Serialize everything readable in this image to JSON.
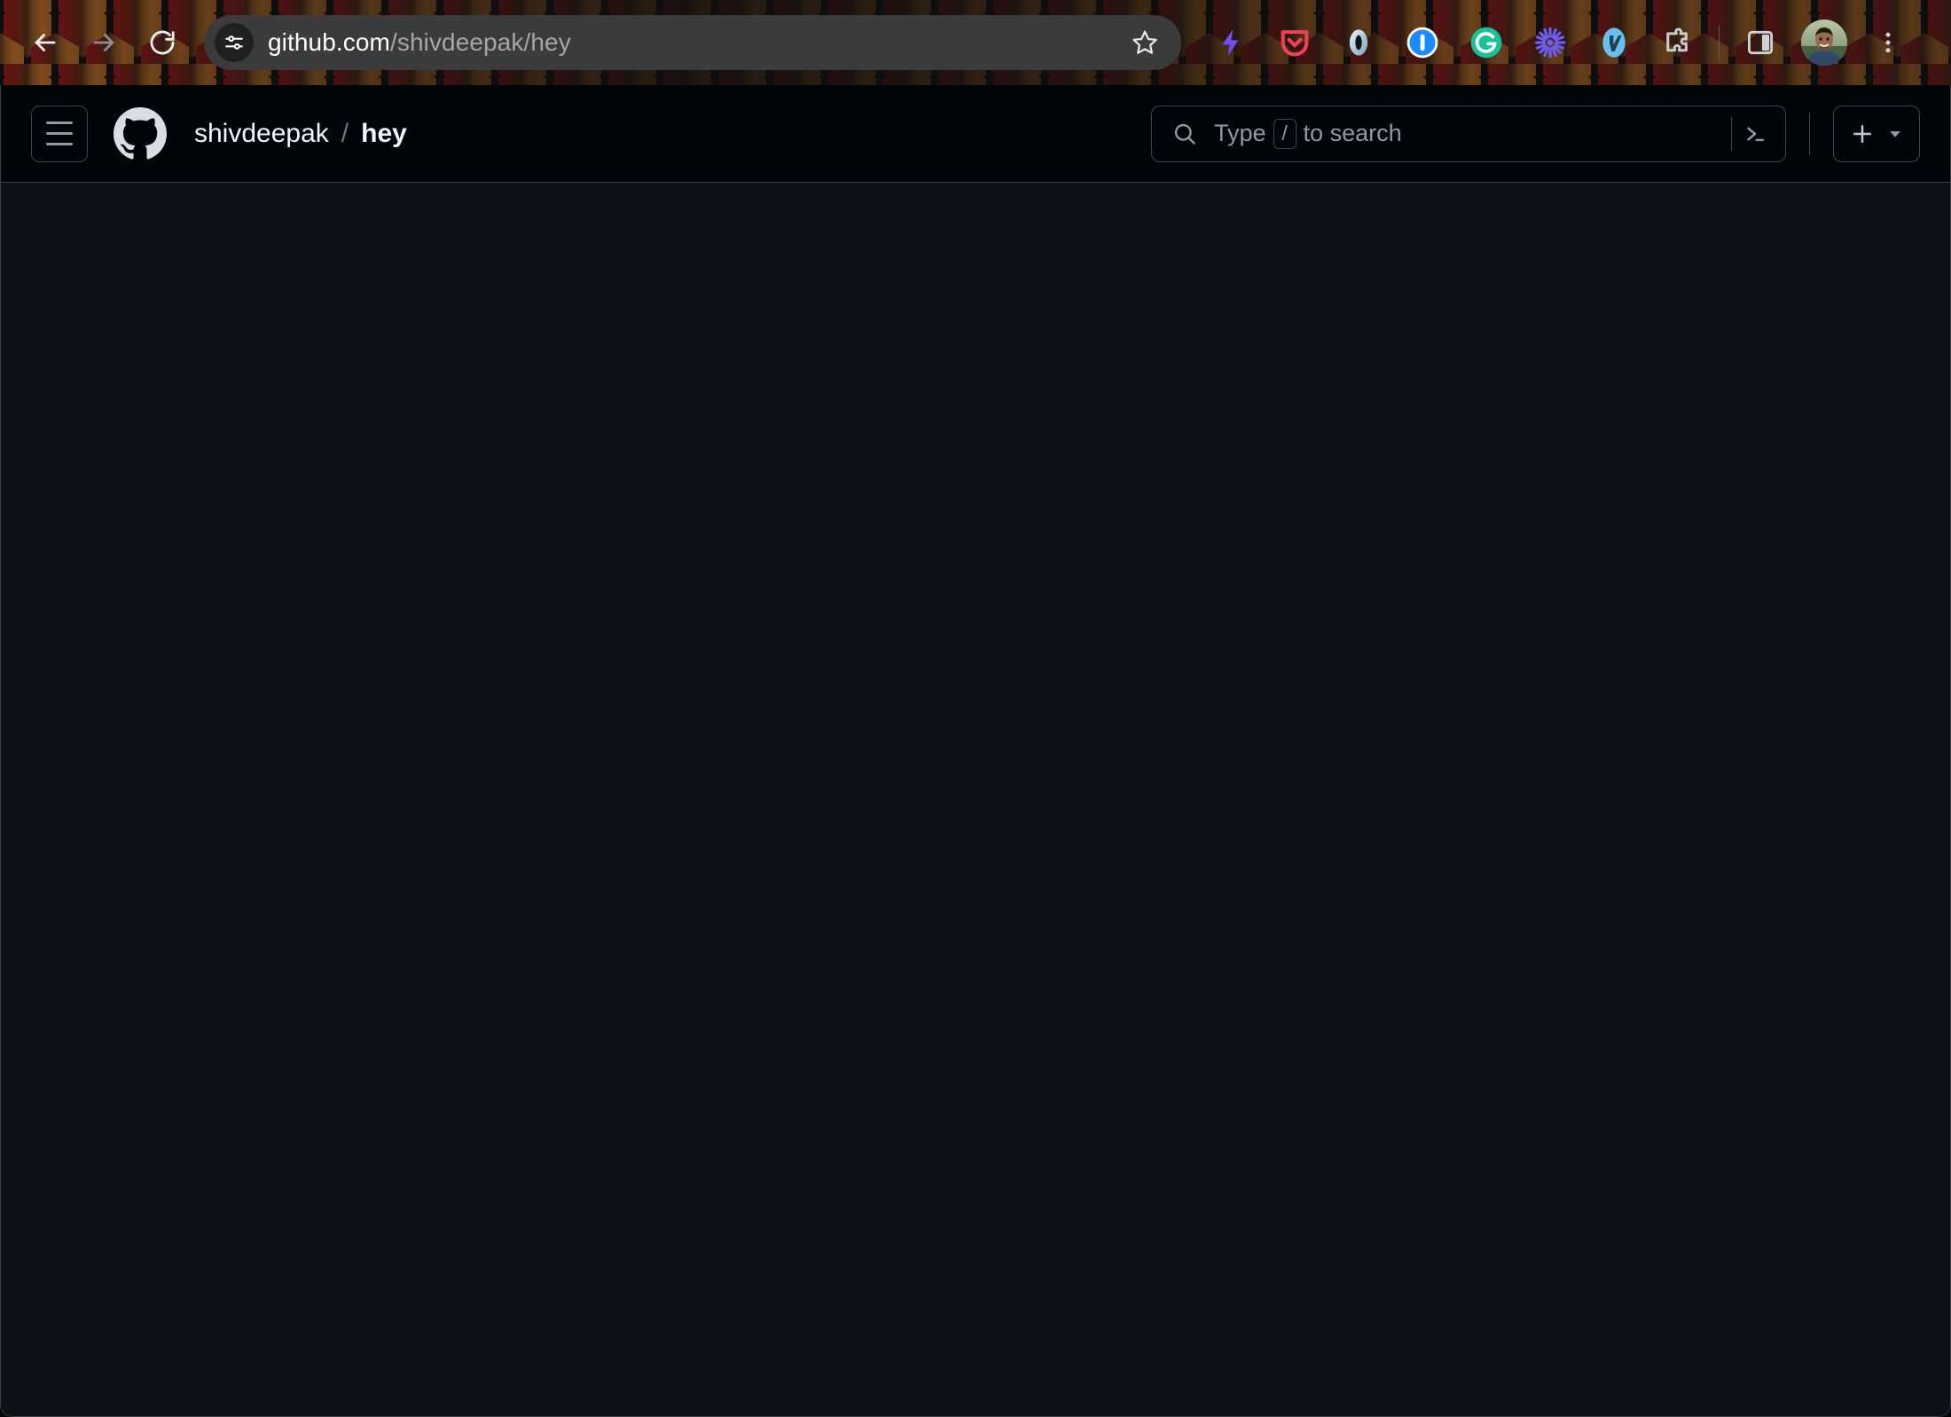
{
  "browser": {
    "nav": {
      "back_label": "Back",
      "forward_label": "Forward",
      "reload_label": "Reload"
    },
    "address_bar": {
      "site_info_label": "View site information",
      "url_domain": "github.com",
      "url_path": "/shivdeepak/hey",
      "full_url": "github.com/shivdeepak/hey",
      "bookmark_label": "Bookmark this tab"
    },
    "extensions": [
      {
        "name": "lightning-bolt-extension-icon",
        "color": "#6c4ff0"
      },
      {
        "name": "pocket-extension-icon",
        "color": "#ef4056"
      },
      {
        "name": "ring-extension-icon",
        "color": "#c3d9e8"
      },
      {
        "name": "1password-extension-icon",
        "color": "#1a8cff"
      },
      {
        "name": "grammarly-extension-icon",
        "color": "#15c39a"
      },
      {
        "name": "asterisk-extension-icon",
        "color": "#6a5cf5"
      },
      {
        "name": "vimium-extension-icon",
        "color": "#67c1ef"
      },
      {
        "name": "extensions-puzzle-icon",
        "color": "#c9cdd2"
      }
    ],
    "side_panel_label": "Side panel",
    "profile_label": "Profile",
    "menu_label": "Customize and control Chrome",
    "theme": {
      "chrome_background": "#111111",
      "hex_left_color": "#6e1414",
      "hex_right_color": "#8a5320",
      "omnibox_background": "#3b3b3b"
    }
  },
  "github": {
    "header": {
      "menu_label": "Open global navigation menu",
      "logo_label": "Homepage",
      "breadcrumb": {
        "owner": "shivdeepak",
        "separator": "/",
        "repo": "hey"
      },
      "search": {
        "placeholder_prefix": "Type",
        "placeholder_key": "/",
        "placeholder_suffix": "to search",
        "command_palette_label": "Command palette"
      },
      "create_new_label": "+",
      "create_new_caret": "Create new..."
    },
    "main": {
      "content": "",
      "state": "loading"
    },
    "theme": {
      "header_background": "#010409",
      "canvas_background": "#0d1117",
      "border_color": "#3d444d",
      "text_primary": "#f0f6fc",
      "text_muted": "#9198a1"
    }
  }
}
